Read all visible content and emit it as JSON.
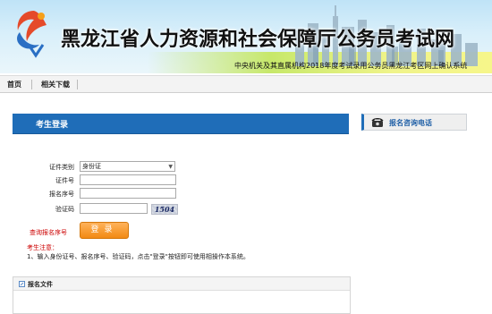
{
  "header": {
    "site_title": "黑龙江省人力资源和社会保障厅公务员考试网",
    "marquee_text": "中央机关及其直属机构2018年度考试录用公务员黑龙江考区网上确认系统"
  },
  "nav": {
    "items": [
      {
        "label": "首页"
      },
      {
        "label": "相关下载"
      }
    ]
  },
  "login": {
    "title": "考生登录",
    "fields": {
      "cert_type_label": "证件类别",
      "cert_type_value": "身份证",
      "cert_no_label": "证件号",
      "reg_no_label": "报名序号",
      "captcha_label": "验证码",
      "captcha_value": "1504"
    },
    "query_link": "查询报名序号",
    "login_button": "登录",
    "notice_title": "考生注意：",
    "notice_text": "1、输入身份证号、报名序号、验证码，点击\"登录\"按钮即可使用相操作本系统。"
  },
  "files": {
    "title": "报名文件"
  },
  "consult": {
    "title": "报名咨询电话"
  },
  "colors": {
    "accent_blue": "#1f6db8",
    "button_orange": "#f28a14",
    "warning_red": "#cc0000"
  },
  "icons": [
    "logo-icon",
    "phone-icon",
    "edit-icon",
    "chevron-down-icon"
  ]
}
